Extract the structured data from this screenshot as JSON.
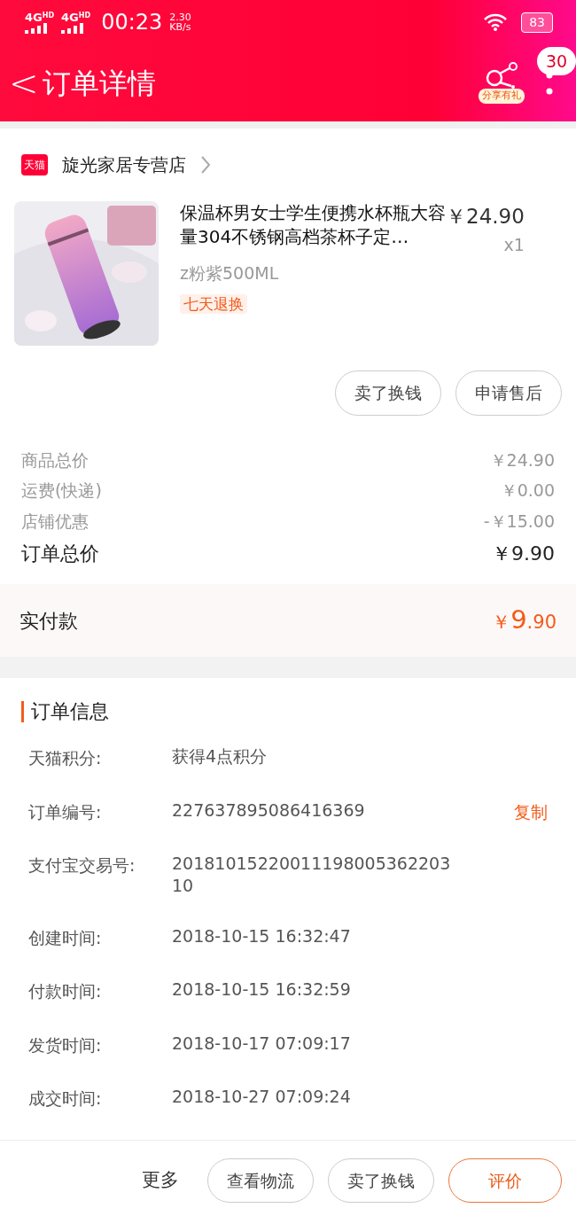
{
  "status_bar": {
    "network_1": "4G",
    "network_1_sup": "HD",
    "network_2": "4G",
    "network_2_sup": "HD",
    "time": "00:23",
    "speed": "2.30",
    "speed_unit": "KB/s",
    "battery": "83"
  },
  "header": {
    "back": "<",
    "title": "订单详情",
    "share_label": "分享有礼",
    "badge": "30"
  },
  "store": {
    "tag": "天猫",
    "name": "旋光家居专营店"
  },
  "product": {
    "title": "保温杯男女士学生便携水杯瓶大容量304不锈钢高档茶杯子定…",
    "price": "￥24.90",
    "quantity": "x1",
    "variant": "z粉紫500ML",
    "tag": "七天退换"
  },
  "item_actions": [
    "卖了换钱",
    "申请售后"
  ],
  "price_rows": [
    {
      "label": "商品总价",
      "value": "￥24.90",
      "kind": "minor"
    },
    {
      "label": "运费(快递)",
      "value": "￥0.00",
      "kind": "minor"
    },
    {
      "label": "店铺优惠",
      "value": "-￥15.00",
      "kind": "minor"
    },
    {
      "label": "订单总价",
      "value": "￥9.90",
      "kind": "total"
    }
  ],
  "paid": {
    "label": "实付款",
    "currency": "￥",
    "integer": "9",
    "decimal": ".90"
  },
  "order_info": {
    "title": "订单信息",
    "rows": [
      {
        "label": "天猫积分:",
        "value": "获得4点积分"
      },
      {
        "label": "订单编号:",
        "value": "227637895086416369",
        "action": "复制"
      },
      {
        "label": "支付宝交易号:",
        "value": "2018101522001119800536220310"
      },
      {
        "label": "创建时间:",
        "value": "2018-10-15 16:32:47"
      },
      {
        "label": "付款时间:",
        "value": "2018-10-15 16:32:59"
      },
      {
        "label": "发货时间:",
        "value": "2018-10-17 07:09:17"
      },
      {
        "label": "成交时间:",
        "value": "2018-10-27 07:09:24"
      }
    ]
  },
  "bottom_bar": {
    "more": "更多",
    "buttons": [
      {
        "label": "查看物流",
        "primary": false
      },
      {
        "label": "卖了换钱",
        "primary": false
      },
      {
        "label": "评价",
        "primary": true
      }
    ]
  }
}
